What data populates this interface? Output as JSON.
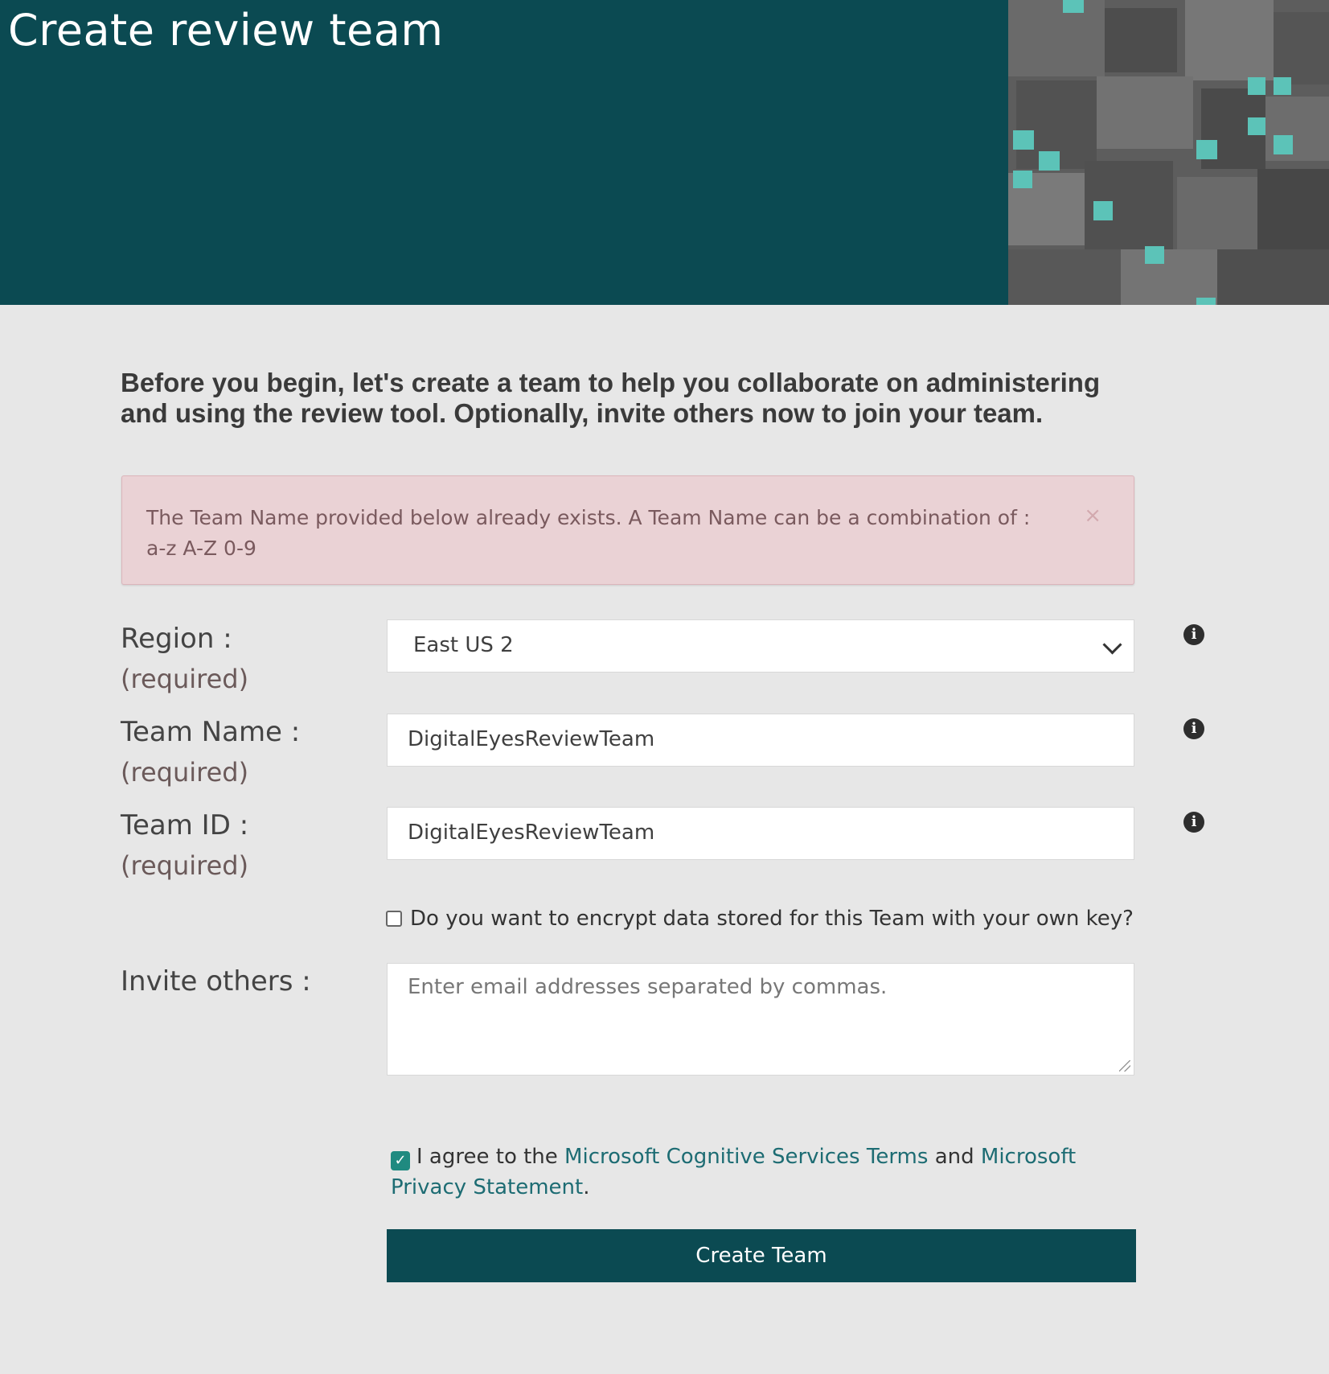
{
  "banner": {
    "title": "Create review team"
  },
  "intro": "Before you begin, let's create a team to help you collaborate on administering and using the review tool. Optionally, invite others now to join your team.",
  "alert": {
    "message": "The Team Name provided below already exists. A Team Name can be a combination of : a-z A-Z 0-9",
    "close_icon": "×"
  },
  "form": {
    "region": {
      "label": "Region :",
      "required": "(required)",
      "value": "East US 2"
    },
    "team_name": {
      "label": "Team Name :",
      "required": "(required)",
      "value": "DigitalEyesReviewTeam"
    },
    "team_id": {
      "label": "Team ID :",
      "required": "(required)",
      "value": "DigitalEyesReviewTeam"
    },
    "encrypt": {
      "label": "Do you want to encrypt data stored for this Team with your own key?",
      "checked": false
    },
    "invite": {
      "label": "Invite others :",
      "placeholder": "Enter email addresses separated by commas."
    },
    "info_icon": "i"
  },
  "agreement": {
    "prefix": "I agree to the",
    "terms_link": "Microsoft Cognitive Services Terms",
    "and": "and",
    "privacy_link": "Microsoft Privacy Statement",
    "suffix": ".",
    "checked": true,
    "check_glyph": "✓"
  },
  "create_button": "Create Team",
  "colors": {
    "banner": "#0b4a52",
    "accent_tile": "#5cc3b8",
    "alert_bg": "#ead2d5",
    "link": "#1d6c73",
    "page_bg": "#e7e7e7"
  }
}
